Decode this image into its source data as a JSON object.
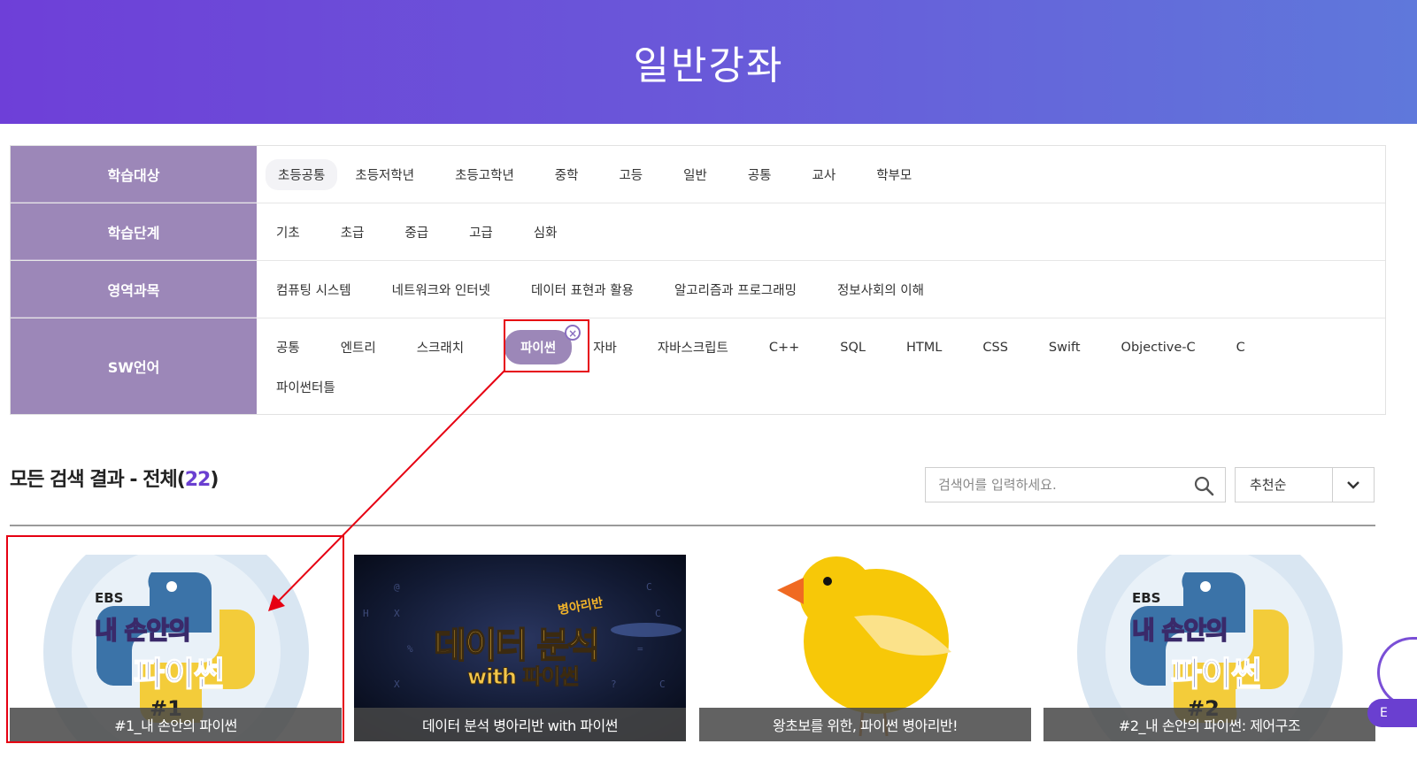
{
  "banner": {
    "title": "일반강좌"
  },
  "filters": {
    "target": {
      "label": "학습대상",
      "options": [
        "초등공통",
        "초등저학년",
        "초등고학년",
        "중학",
        "고등",
        "일반",
        "공통",
        "교사",
        "학부모"
      ]
    },
    "level": {
      "label": "학습단계",
      "options": [
        "기초",
        "초급",
        "중급",
        "고급",
        "심화"
      ]
    },
    "subject": {
      "label": "영역과목",
      "options": [
        "컴퓨팅 시스템",
        "네트워크와 인터넷",
        "데이터 표현과 활용",
        "알고리즘과 프로그래밍",
        "정보사회의 이해"
      ]
    },
    "language": {
      "label": "SW언어",
      "options": [
        "공통",
        "엔트리",
        "스크래치",
        "파이썬",
        "자바",
        "자바스크립트",
        "C++",
        "SQL",
        "HTML",
        "CSS",
        "Swift",
        "Objective-C",
        "C",
        "파이썬터틀"
      ],
      "selected": "파이썬"
    }
  },
  "results": {
    "title_prefix": "모든 검색 결과 - 전체(",
    "count": "22",
    "title_suffix": ")"
  },
  "search": {
    "placeholder": "검색어를 입력하세요."
  },
  "sort": {
    "value": "추천순"
  },
  "courses": [
    {
      "title": "#1_내 손안의 파이썬",
      "thumb": {
        "brand": "EBS",
        "line1": "내 손안의",
        "line2": "파이썬",
        "ep": "#1"
      }
    },
    {
      "title": "데이터 분석 병아리반 with 파이썬",
      "thumb": {
        "line1": "데이터 분석",
        "tag": "병아리반",
        "line2": "with 파이썬"
      }
    },
    {
      "title": "왕초보를 위한, 파이썬 병아리반!"
    },
    {
      "title": "#2_내 손안의 파이썬: 제어구조",
      "thumb": {
        "brand": "EBS",
        "line1": "내 손안의",
        "line2": "파이썬",
        "ep": "#2"
      }
    }
  ],
  "edge_badge": "E",
  "colors": {
    "accent": "#6a3fd0",
    "filter_label_bg": "#9c87b8",
    "highlight": "#e60012"
  }
}
